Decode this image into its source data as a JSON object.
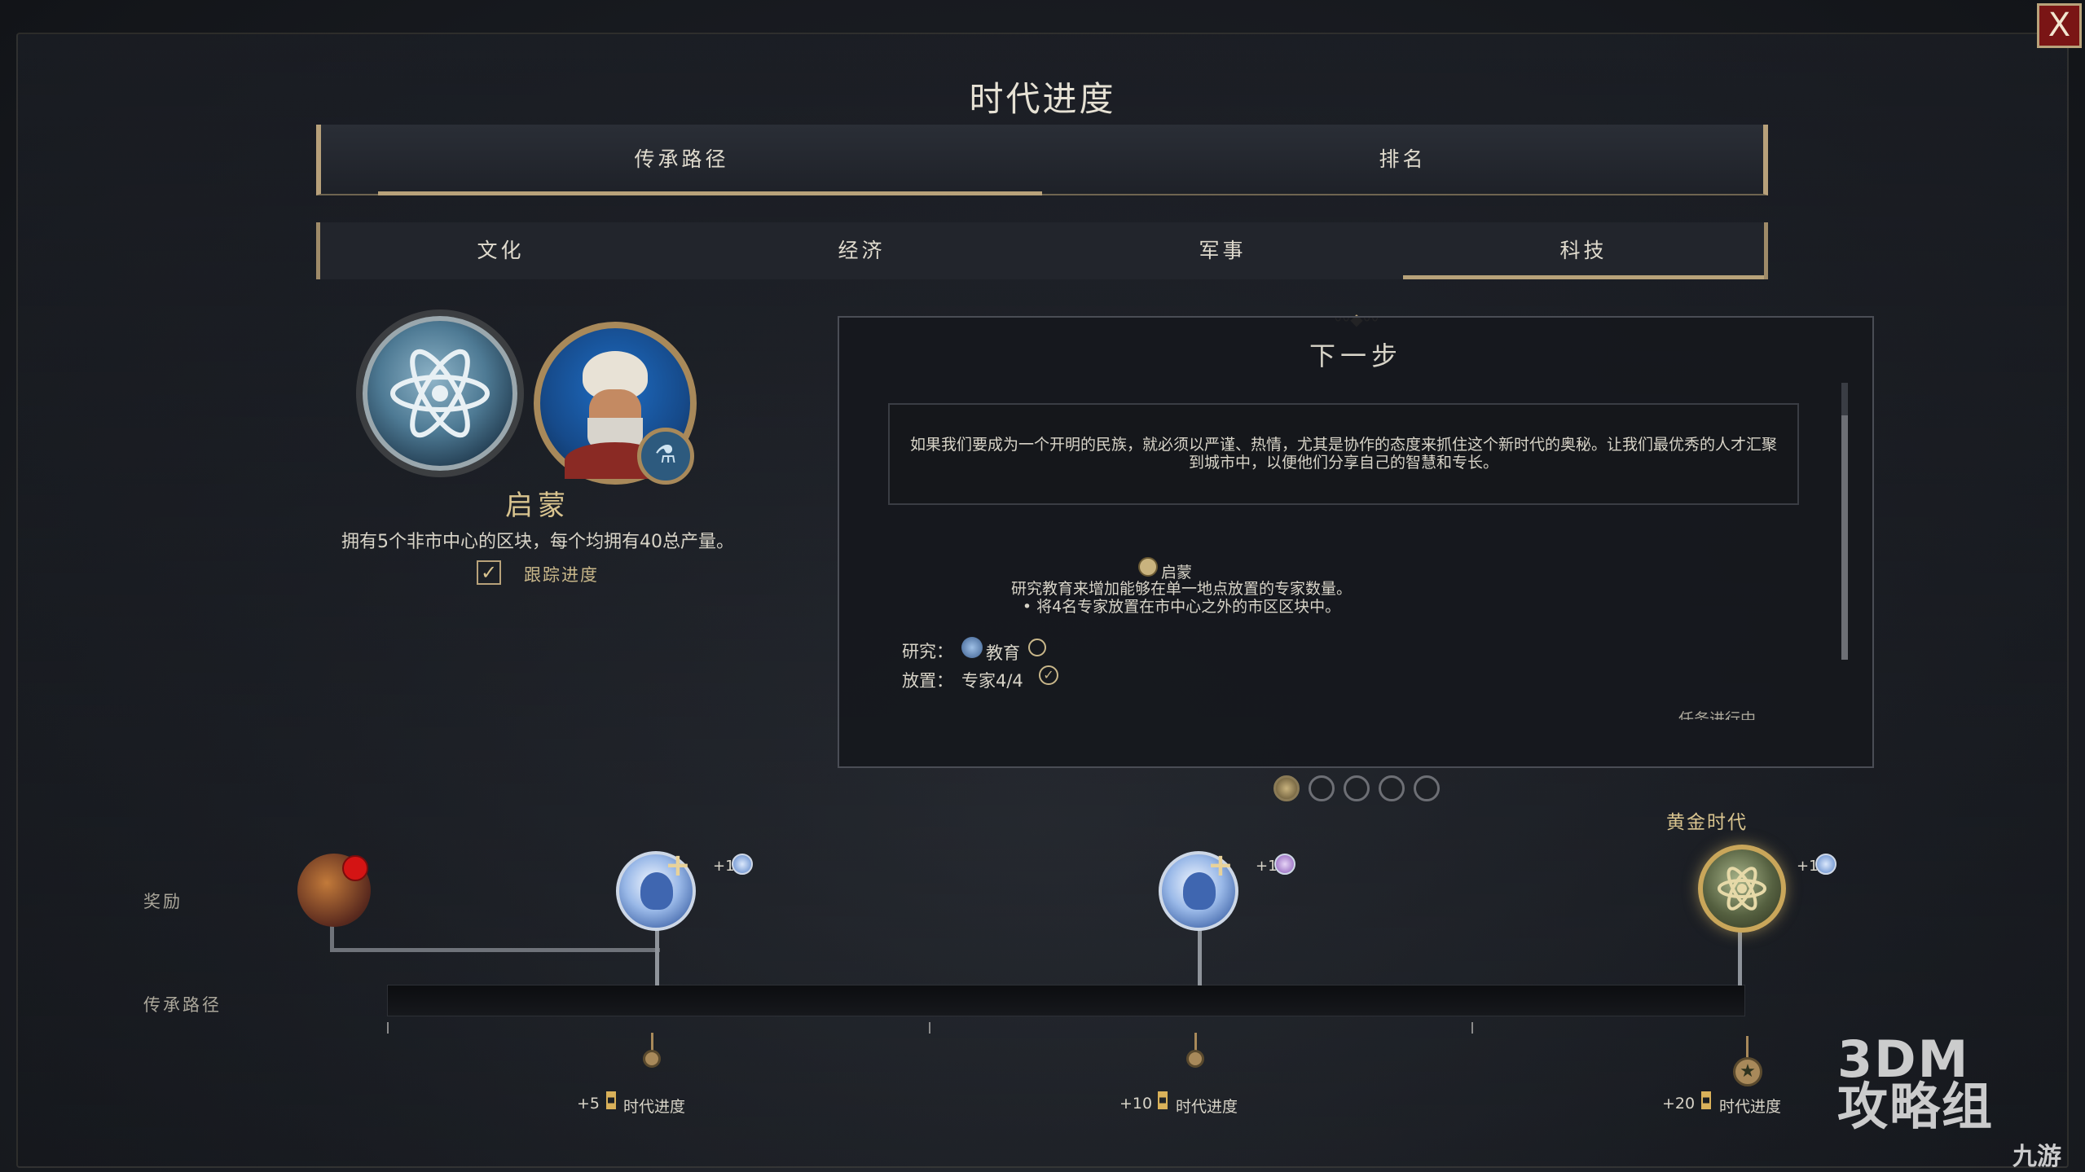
{
  "header": {
    "title": "时代进度",
    "close_label": "X"
  },
  "main_tabs": [
    {
      "label": "传承路径",
      "active": true
    },
    {
      "label": "排名",
      "active": false
    }
  ],
  "sub_tabs": [
    {
      "label": "文化",
      "active": false
    },
    {
      "label": "经济",
      "active": false
    },
    {
      "label": "军事",
      "active": false
    },
    {
      "label": "科技",
      "active": true
    }
  ],
  "goal": {
    "name": "启蒙",
    "description": "拥有5个非市中心的区块，每个均拥有40总产量。",
    "track_label": "跟踪进度",
    "tracking": true
  },
  "next_step": {
    "title": "下一步",
    "quote": "如果我们要成为一个开明的民族，就必须以严谨、热情，尤其是协作的态度来抓住这个新时代的奥秘。让我们最优秀的人才汇聚到城市中，以便他们分享自己的智慧和专长。",
    "tech_name": "启蒙",
    "tech_desc_line1": "研究教育来增加能够在单一地点放置的专家数量。",
    "tech_desc_line2": "• 将4名专家放置在市中心之外的市区区块中。",
    "req_research_label": "研究：",
    "req_research_value": "教育",
    "req_research_done": false,
    "req_place_label": "放置：",
    "req_place_value": "专家4/4",
    "req_place_done": true,
    "status": "任务进行中"
  },
  "pagination": {
    "total": 5,
    "current": 1
  },
  "track": {
    "reward_row_label": "奖励",
    "path_row_label": "传承路径",
    "golden_age_label": "黄金时代",
    "rewards": [
      {
        "bonus": "+1",
        "bonus_icon": "science-icon"
      },
      {
        "bonus": "+1",
        "bonus_icon": "culture-icon"
      },
      {
        "bonus": "+1",
        "bonus_icon": "science-icon"
      }
    ],
    "milestones": [
      {
        "amount": "+5",
        "label": "时代进度"
      },
      {
        "amount": "+10",
        "label": "时代进度"
      },
      {
        "amount": "+20",
        "label": "时代进度"
      }
    ]
  },
  "watermark": {
    "line1": "3DM",
    "line2": "攻略组",
    "site": "九游"
  },
  "colors": {
    "accent": "#b8a27a",
    "gold": "#d9c48f",
    "close_bg": "#7a1515"
  }
}
